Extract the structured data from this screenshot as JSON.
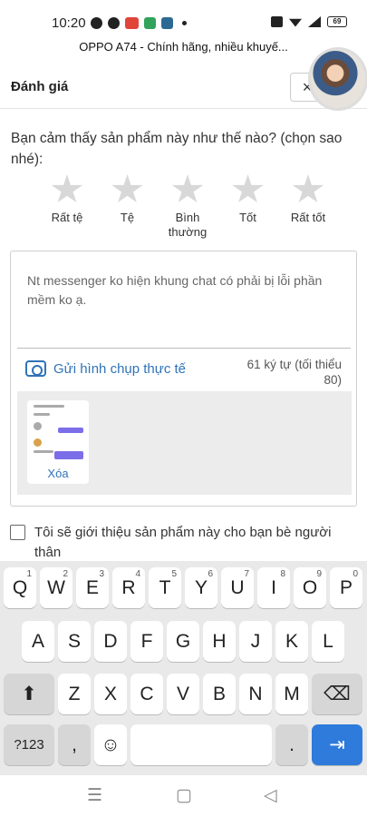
{
  "status_bar": {
    "time": "10:20",
    "battery": "69"
  },
  "page_heading": "OPPO A74 - Chính hãng, nhiều khuyế...",
  "header": {
    "title": "Đánh giá",
    "close_label": "×"
  },
  "rating": {
    "question": "Bạn cảm thấy sản phẩm này như thế nào? (chọn sao nhé):",
    "options": [
      "Rất tệ",
      "Tệ",
      "Bình thường",
      "Tốt",
      "Rất tốt"
    ]
  },
  "review": {
    "text": "Nt messenger ko hiện khung chat có phải bị lỗi phần mềm ko ạ.",
    "photo_label": "Gửi hình chụp thực tế",
    "char_count": "61 ký tự (tối thiểu 80)",
    "delete_label": "Xóa"
  },
  "recommend": {
    "text": "Tôi sẽ giới thiệu sản phẩm này cho bạn bè người thân"
  },
  "keyboard": {
    "row1": [
      "Q",
      "W",
      "E",
      "R",
      "T",
      "Y",
      "U",
      "I",
      "O",
      "P"
    ],
    "row1_numbers": [
      "1",
      "2",
      "3",
      "4",
      "5",
      "6",
      "7",
      "8",
      "9",
      "0"
    ],
    "row2": [
      "A",
      "S",
      "D",
      "F",
      "G",
      "H",
      "J",
      "K",
      "L"
    ],
    "row3": [
      "Z",
      "X",
      "C",
      "V",
      "B",
      "N",
      "M"
    ],
    "numbers_key": "?123",
    "comma_key": ",",
    "period_key": ".",
    "emoji": "☺",
    "enter": "⇥",
    "shift": "⬆",
    "backspace": "⌫"
  },
  "nav_bar": {
    "menu": "☰",
    "home": "▢",
    "back": "◁"
  },
  "colors": {
    "accent": "#2f73b8",
    "star_inactive": "#d8d8d8",
    "key_accent": "#2e7bdc"
  }
}
